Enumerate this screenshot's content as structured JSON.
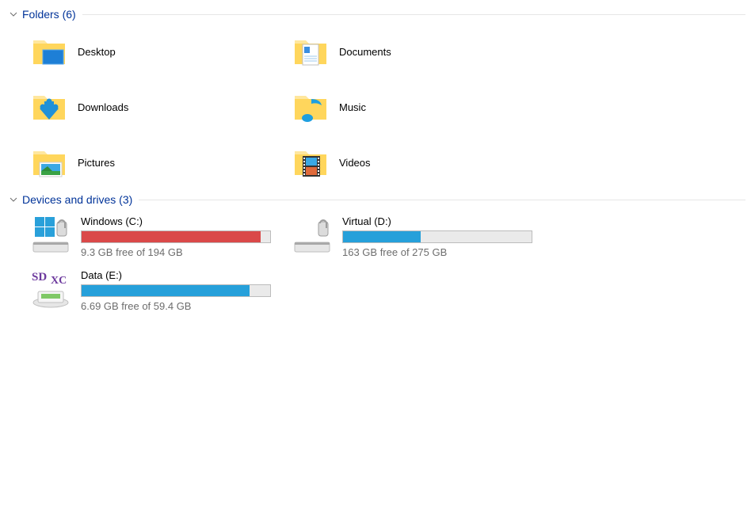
{
  "folders_section": {
    "title_label": "Folders",
    "count_label": "(6)",
    "items": [
      {
        "id": "desktop",
        "label": "Desktop"
      },
      {
        "id": "documents",
        "label": "Documents"
      },
      {
        "id": "downloads",
        "label": "Downloads"
      },
      {
        "id": "music",
        "label": "Music"
      },
      {
        "id": "pictures",
        "label": "Pictures"
      },
      {
        "id": "videos",
        "label": "Videos"
      }
    ]
  },
  "drives_section": {
    "title_label": "Devices and drives",
    "count_label": "(3)",
    "items": [
      {
        "id": "c",
        "label": "Windows (C:)",
        "free_label": "9.3 GB free of 194 GB",
        "used_pct": 95,
        "low_space": true
      },
      {
        "id": "d",
        "label": "Virtual (D:)",
        "free_label": "163 GB free of 275 GB",
        "used_pct": 41,
        "low_space": false
      },
      {
        "id": "e",
        "label": "Data (E:)",
        "free_label": "6.69 GB free of 59.4 GB",
        "used_pct": 89,
        "low_space": false
      }
    ]
  },
  "colors": {
    "accent_blue": "#26a0da",
    "warning_red": "#da4949"
  }
}
